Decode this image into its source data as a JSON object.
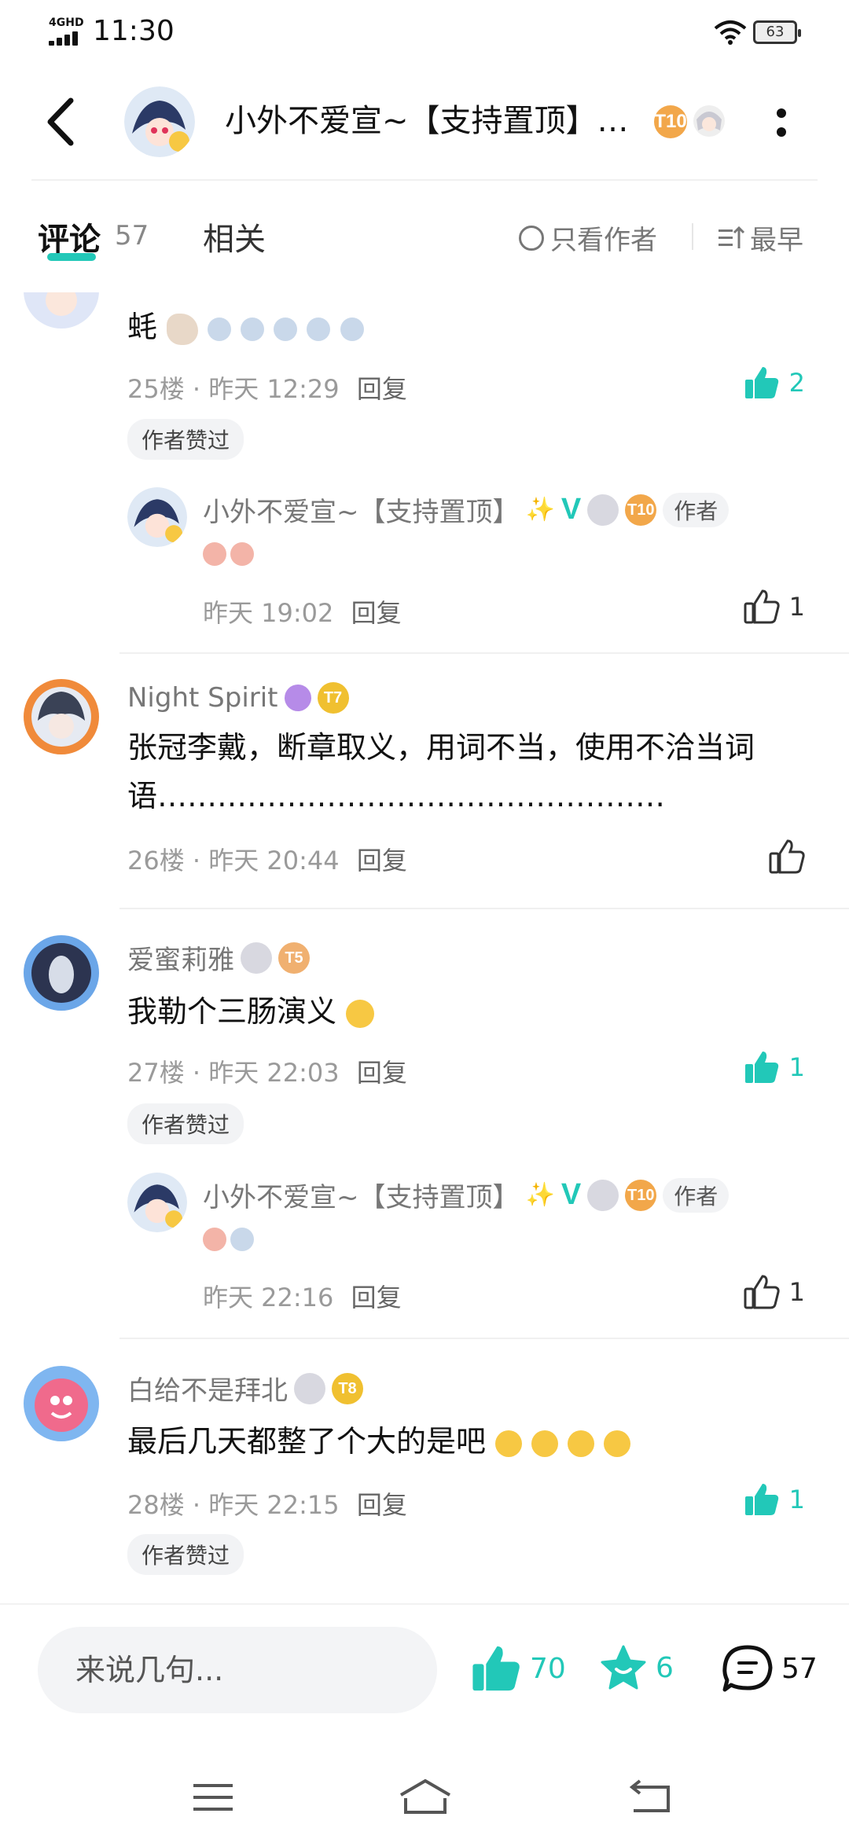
{
  "status_bar": {
    "network": "4GHD",
    "time": "11:30",
    "battery": "63"
  },
  "header": {
    "title": "小外不爱宣~【支持置顶】…",
    "level": "T10"
  },
  "tabs": {
    "comments_label": "评论",
    "comments_count": "57",
    "related_label": "相关",
    "only_author_label": "只看作者",
    "sort_label": "最早"
  },
  "comments": [
    {
      "content": "蚝",
      "floor": "25楼",
      "time": "昨天 12:29",
      "reply": "回复",
      "likes": "2",
      "liked_by_author": "作者赞过",
      "sub": {
        "name": "小外不爱宣~【支持置顶】",
        "level": "T10",
        "author_tag": "作者",
        "time": "昨天 19:02",
        "reply": "回复",
        "likes": "1"
      }
    },
    {
      "name": "Night Spirit",
      "level": "T7",
      "content": "张冠李戴，断章取义，用词不当，使用不洽当词语……………………………………………",
      "floor": "26楼",
      "time": "昨天 20:44",
      "reply": "回复"
    },
    {
      "name": "爱蜜莉雅",
      "level": "T5",
      "content": "我勒个三肠演义",
      "floor": "27楼",
      "time": "昨天 22:03",
      "reply": "回复",
      "likes": "1",
      "liked_by_author": "作者赞过",
      "sub": {
        "name": "小外不爱宣~【支持置顶】",
        "level": "T10",
        "author_tag": "作者",
        "time": "昨天 22:16",
        "reply": "回复",
        "likes": "1"
      }
    },
    {
      "name": "白给不是拜北",
      "level": "T8",
      "content": "最后几天都整了个大的是吧",
      "floor": "28楼",
      "time": "昨天 22:15",
      "reply": "回复",
      "likes": "1",
      "liked_by_author": "作者赞过"
    }
  ],
  "bottom_bar": {
    "input_placeholder": "来说几句...",
    "likes": "70",
    "favorites": "6",
    "comments": "57"
  },
  "colors": {
    "accent": "#22c8b8",
    "level_badge": "#f2a74a"
  }
}
